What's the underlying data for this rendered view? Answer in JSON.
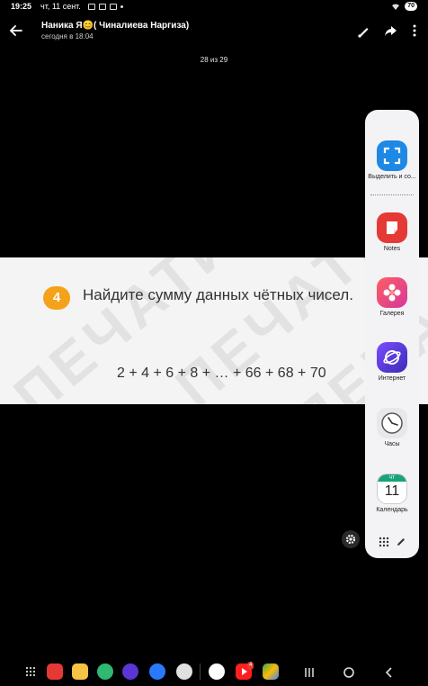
{
  "status": {
    "time": "19:25",
    "date": "чт, 11 сент.",
    "battery": "70"
  },
  "header": {
    "sender": "Наника Я😊( Чиналиева Наргиза)",
    "subtitle": "сегодня в 18:04"
  },
  "counter": "28 из 29",
  "photo": {
    "watermark": "ПЕЧАТИ",
    "task_number": "4",
    "task_text": "Найдите сумму данных чётных чисел.",
    "expression": "2 + 4 + 6 + 8 + … + 66 + 68 + 70"
  },
  "edge_panel": {
    "apps": [
      {
        "label": "Выделить и со...",
        "icon": "smart-select-icon",
        "color": "#1e88e5"
      },
      {
        "label": "Notes",
        "icon": "notes-icon",
        "color": "#e53935"
      },
      {
        "label": "Галерея",
        "icon": "gallery-icon",
        "color": "#ec407a"
      },
      {
        "label": "Интернет",
        "icon": "internet-icon",
        "color": "#5c35d6"
      },
      {
        "label": "Часы",
        "icon": "clock-icon",
        "color": "#e8e8ea"
      },
      {
        "label": "Календарь",
        "icon": "calendar-icon",
        "color": "#ffffff"
      }
    ],
    "calendar_day": "ЧТ",
    "calendar_date": "11"
  },
  "dock": {
    "badge": "4"
  }
}
